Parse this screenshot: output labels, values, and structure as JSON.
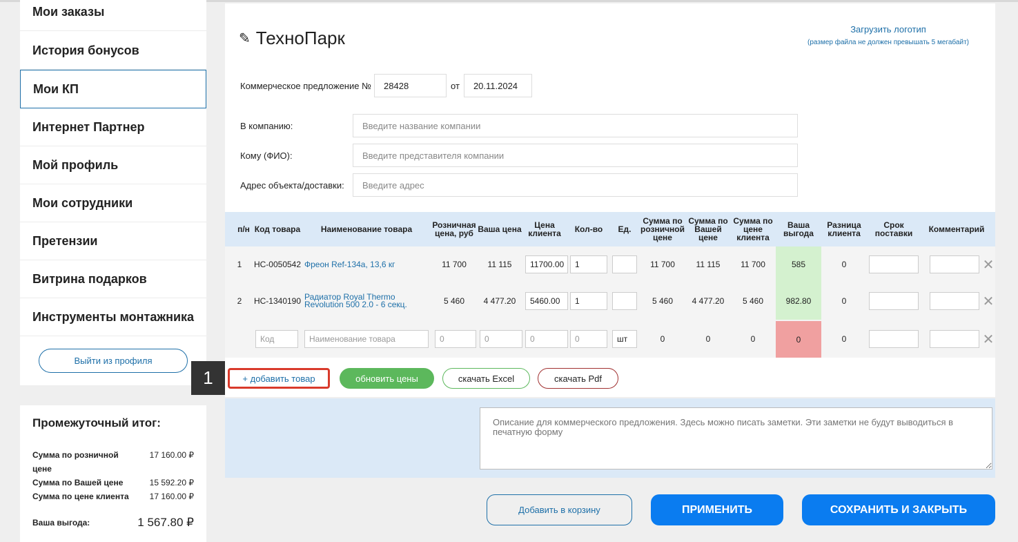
{
  "sidebar": {
    "items": [
      {
        "label": "Мои заказы"
      },
      {
        "label": "История бонусов"
      },
      {
        "label": "Мои КП"
      },
      {
        "label": "Интернет Партнер"
      },
      {
        "label": "Мой профиль"
      },
      {
        "label": "Мои сотрудники"
      },
      {
        "label": "Претензии"
      },
      {
        "label": "Витрина подарков"
      },
      {
        "label": "Инструменты монтажника"
      }
    ],
    "logout_label": "Выйти из профиля"
  },
  "subtotal": {
    "title": "Промежуточный итог:",
    "rows": [
      {
        "label": "Сумма по розничной цене",
        "value": "17 160.00 ₽"
      },
      {
        "label": "Сумма по Вашей цене",
        "value": "15 592.20 ₽"
      },
      {
        "label": "Сумма по цене клиента",
        "value": "17 160.00 ₽"
      }
    ],
    "benefit_label": "Ваша выгода:",
    "benefit_value": "1 567.80 ₽"
  },
  "header": {
    "title": "ТехноПарк",
    "upload_link": "Загрузить логотип",
    "upload_hint": "(размер файла не должен превышать 5 мегабайт)"
  },
  "offer": {
    "label": "Коммерческое предложение №",
    "number": "28428",
    "from_label": "от",
    "date": "20.11.2024"
  },
  "fields": [
    {
      "label": "В компанию:",
      "placeholder": "Введите название компании"
    },
    {
      "label": "Кому (ФИО):",
      "placeholder": "Введите представителя компании"
    },
    {
      "label": "Адрес объекта/доставки:",
      "placeholder": "Введите адрес"
    }
  ],
  "table": {
    "headers": [
      "п/н",
      "Код товара",
      "Наименование товара",
      "Розничная цена, руб",
      "Ваша цена",
      "Цена клиента",
      "Кол-во",
      "Ед.",
      "Сумма по розничной цене",
      "Сумма по Вашей цене",
      "Сумма по цене клиента",
      "Ваша выгода",
      "Разница клиента",
      "Срок поставки",
      "Комментарий"
    ],
    "rows": [
      {
        "n": "1",
        "code": "НС-0050542",
        "name": "Фреон Ref-134a, 13,6 кг",
        "retail": "11 700",
        "your": "11 115",
        "client": "11700.00",
        "qty": "1",
        "sum_retail": "11 700",
        "sum_your": "11 115",
        "sum_client": "11 700",
        "benefit": "585",
        "diff": "0"
      },
      {
        "n": "2",
        "code": "НС-1340190",
        "name": "Радиатор Royal Thermo Revolution 500 2.0 - 6 секц.",
        "retail": "5 460",
        "your": "4 477.20",
        "client": "5460.00",
        "qty": "1",
        "sum_retail": "5 460",
        "sum_your": "4 477.20",
        "sum_client": "5 460",
        "benefit": "982.80",
        "diff": "0"
      }
    ],
    "new_row": {
      "code_placeholder": "Код",
      "name_placeholder": "Наименование товара",
      "retail_placeholder": "0",
      "your_placeholder": "0",
      "client_placeholder": "0",
      "qty_placeholder": "0",
      "unit": "шт",
      "sum_retail": "0",
      "sum_your": "0",
      "sum_client": "0",
      "benefit": "0",
      "diff": "0"
    },
    "close_glyph": "✕"
  },
  "actions": {
    "add_item": "+ добавить товар",
    "update_prices": "обновить цены",
    "download_excel": "скачать Excel",
    "download_pdf": "скачать Pdf"
  },
  "marker": "1",
  "description_placeholder": "Описание для коммерческого предложения. Здесь можно писать заметки. Эти заметки не будут выводиться в печатную форму",
  "bottom": {
    "add_to_cart": "Добавить в корзину",
    "apply": "ПРИМЕНИТЬ",
    "save_close": "СОХРАНИТЬ И ЗАКРЫТЬ"
  },
  "colors": {
    "accent": "#1d6fa8",
    "primary_button": "#0a7cf0",
    "benefit_positive": "#d4f1cf",
    "benefit_zero": "#f0a0a0",
    "update_button": "#5cb85c"
  }
}
